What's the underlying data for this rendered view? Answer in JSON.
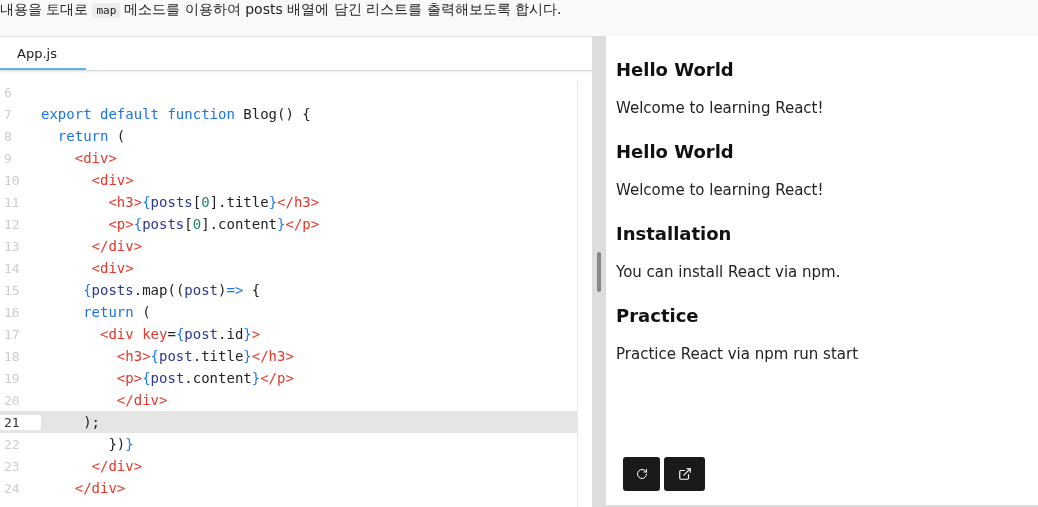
{
  "instruction": {
    "before": "내용을 토대로",
    "code": "map",
    "after": "메소드를 이용하여 posts 배열에 담긴 리스트를 출력해보도록 합시다."
  },
  "tabs": [
    {
      "label": "App.js",
      "selected": true
    }
  ],
  "code_lines": [
    {
      "number": "6",
      "active": false
    },
    {
      "number": "7",
      "active": false,
      "tokens": [
        {
          "kind": "kw",
          "text": "export default function "
        },
        {
          "kind": "plain",
          "text": "Blog() {"
        }
      ]
    },
    {
      "number": "8",
      "active": false,
      "tokens": [
        {
          "kind": "kw",
          "text": "  return "
        },
        {
          "kind": "plain",
          "text": "("
        }
      ]
    },
    {
      "number": "9",
      "active": false,
      "tokens": [
        {
          "kind": "tag",
          "text": "    <div>"
        }
      ]
    },
    {
      "number": "10",
      "active": false,
      "tokens": [
        {
          "kind": "tag",
          "text": "      <div>"
        }
      ]
    },
    {
      "number": "11",
      "active": false,
      "tokens": [
        {
          "kind": "tag",
          "text": "        <h3>"
        },
        {
          "kind": "brace",
          "text": "{"
        },
        {
          "kind": "var",
          "text": "posts"
        },
        {
          "kind": "plain",
          "text": "["
        },
        {
          "kind": "num",
          "text": "0"
        },
        {
          "kind": "plain",
          "text": "].title"
        },
        {
          "kind": "brace",
          "text": "}"
        },
        {
          "kind": "tag",
          "text": "</h3>"
        }
      ]
    },
    {
      "number": "12",
      "active": false,
      "tokens": [
        {
          "kind": "tag",
          "text": "        <p>"
        },
        {
          "kind": "brace",
          "text": "{"
        },
        {
          "kind": "var",
          "text": "posts"
        },
        {
          "kind": "plain",
          "text": "["
        },
        {
          "kind": "num",
          "text": "0"
        },
        {
          "kind": "plain",
          "text": "].content"
        },
        {
          "kind": "brace",
          "text": "}"
        },
        {
          "kind": "tag",
          "text": "</p>"
        }
      ]
    },
    {
      "number": "13",
      "active": false,
      "tokens": [
        {
          "kind": "tag",
          "text": "      </div>"
        }
      ]
    },
    {
      "number": "14",
      "active": false,
      "tokens": [
        {
          "kind": "tag",
          "text": "      <div>"
        }
      ]
    },
    {
      "number": "15",
      "active": false,
      "tokens": [
        {
          "kind": "brace",
          "text": "     {"
        },
        {
          "kind": "var",
          "text": "posts"
        },
        {
          "kind": "plain",
          "text": ".map(("
        },
        {
          "kind": "var",
          "text": "post"
        },
        {
          "kind": "plain",
          "text": ")"
        },
        {
          "kind": "kw",
          "text": "=>"
        },
        {
          "kind": "plain",
          "text": " {"
        }
      ]
    },
    {
      "number": "16",
      "active": false,
      "tokens": [
        {
          "kind": "kw",
          "text": "     return "
        },
        {
          "kind": "plain",
          "text": "("
        }
      ]
    },
    {
      "number": "17",
      "active": false,
      "tokens": [
        {
          "kind": "tag",
          "text": "       <div key"
        },
        {
          "kind": "plain",
          "text": "="
        },
        {
          "kind": "brace",
          "text": "{"
        },
        {
          "kind": "var",
          "text": "post"
        },
        {
          "kind": "plain",
          "text": ".id"
        },
        {
          "kind": "brace",
          "text": "}"
        },
        {
          "kind": "tag",
          "text": ">"
        }
      ]
    },
    {
      "number": "18",
      "active": false,
      "tokens": [
        {
          "kind": "tag",
          "text": "         <h3>"
        },
        {
          "kind": "brace",
          "text": "{"
        },
        {
          "kind": "var",
          "text": "post"
        },
        {
          "kind": "plain",
          "text": ".title"
        },
        {
          "kind": "brace",
          "text": "}"
        },
        {
          "kind": "tag",
          "text": "</h3>"
        }
      ]
    },
    {
      "number": "19",
      "active": false,
      "tokens": [
        {
          "kind": "tag",
          "text": "         <p>"
        },
        {
          "kind": "brace",
          "text": "{"
        },
        {
          "kind": "var",
          "text": "post"
        },
        {
          "kind": "plain",
          "text": ".content"
        },
        {
          "kind": "brace",
          "text": "}"
        },
        {
          "kind": "tag",
          "text": "</p>"
        }
      ]
    },
    {
      "number": "20",
      "active": false,
      "tokens": [
        {
          "kind": "tag",
          "text": "         </div>"
        }
      ]
    },
    {
      "number": "21",
      "active": true,
      "tokens": [
        {
          "kind": "plain",
          "text": "     );"
        }
      ]
    },
    {
      "number": "22",
      "active": false,
      "tokens": [
        {
          "kind": "plain",
          "text": "        })"
        },
        {
          "kind": "brace",
          "text": "}"
        }
      ]
    },
    {
      "number": "23",
      "active": false,
      "tokens": [
        {
          "kind": "tag",
          "text": "      </div>"
        }
      ]
    },
    {
      "number": "24",
      "active": false,
      "tokens": [
        {
          "kind": "tag",
          "text": "    </div>"
        }
      ]
    }
  ],
  "preview": [
    {
      "kind": "heading",
      "text": "Hello World"
    },
    {
      "kind": "paragraph",
      "text": "Welcome to learning React!"
    },
    {
      "kind": "heading",
      "text": "Hello World"
    },
    {
      "kind": "paragraph",
      "text": "Welcome to learning React!"
    },
    {
      "kind": "heading",
      "text": "Installation"
    },
    {
      "kind": "paragraph",
      "text": "You can install React via npm."
    },
    {
      "kind": "heading",
      "text": "Practice"
    },
    {
      "kind": "paragraph",
      "text": "Practice React via npm run start"
    }
  ]
}
